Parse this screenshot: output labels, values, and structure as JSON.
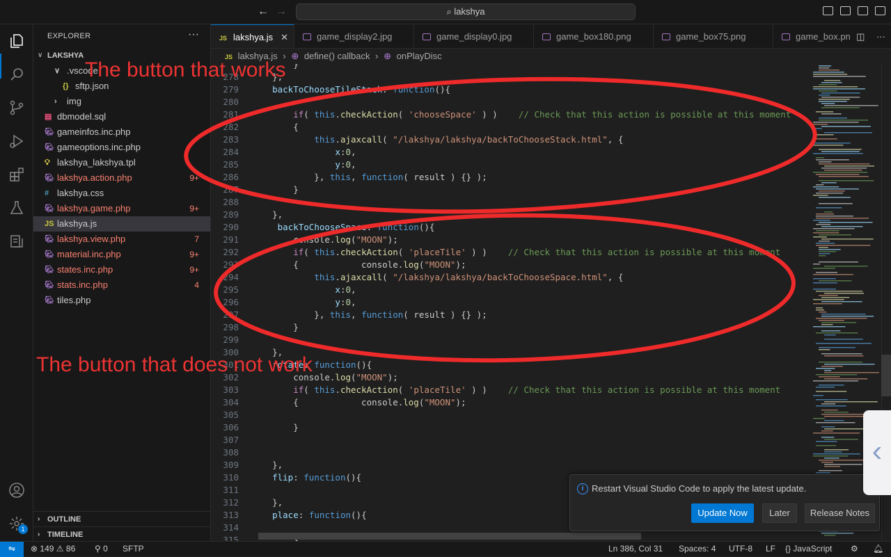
{
  "titlebar": {
    "search_text": "lakshya"
  },
  "explorer": {
    "title": "EXPLORER",
    "more": "···",
    "root": "LAKSHYA",
    "items": [
      {
        "name": ".vscode",
        "icon": "chevron-down",
        "color": "#cccccc"
      },
      {
        "name": "sftp.json",
        "icon": "{}",
        "color": "#cccccc"
      },
      {
        "name": "img",
        "icon": "chevron-right",
        "color": "#cccccc"
      },
      {
        "name": "dbmodel.sql",
        "icon": "database-icon",
        "color": "#cccccc"
      },
      {
        "name": "gameinfos.inc.php",
        "icon": "php-icon",
        "color": "#cccccc"
      },
      {
        "name": "gameoptions.inc.php",
        "icon": "php-icon",
        "color": "#cccccc"
      },
      {
        "name": "lakshya_lakshya.tpl",
        "icon": "bulb-icon",
        "color": "#cccccc"
      },
      {
        "name": "lakshya.action.php",
        "icon": "php-icon",
        "color": "#f88070",
        "badge": "9+"
      },
      {
        "name": "lakshya.css",
        "icon": "#",
        "color": "#cccccc"
      },
      {
        "name": "lakshya.game.php",
        "icon": "php-icon",
        "color": "#f88070",
        "badge": "9+"
      },
      {
        "name": "lakshya.js",
        "icon": "JS",
        "color": "#cccccc"
      },
      {
        "name": "lakshya.view.php",
        "icon": "php-icon",
        "color": "#f88070",
        "badge": "7"
      },
      {
        "name": "material.inc.php",
        "icon": "php-icon",
        "color": "#f88070",
        "badge": "9+"
      },
      {
        "name": "states.inc.php",
        "icon": "php-icon",
        "color": "#f88070",
        "badge": "9+"
      },
      {
        "name": "stats.inc.php",
        "icon": "php-icon",
        "color": "#f88070",
        "badge": "4"
      },
      {
        "name": "tiles.php",
        "icon": "php-icon",
        "color": "#cccccc"
      }
    ],
    "outline": "OUTLINE",
    "timeline": "TIMELINE"
  },
  "tabs": [
    {
      "label": "lakshya.js",
      "icon": "JS",
      "active": true
    },
    {
      "label": "game_display2.jpg",
      "icon": "image"
    },
    {
      "label": "game_display0.jpg",
      "icon": "image"
    },
    {
      "label": "game_box180.png",
      "icon": "image"
    },
    {
      "label": "game_box75.png",
      "icon": "image"
    },
    {
      "label": "game_box.pn",
      "icon": "image"
    }
  ],
  "breadcrumb": {
    "file": "lakshya.js",
    "sep": "›",
    "seg1": "define() callback",
    "seg2": "onPlayDisc"
  },
  "code_lines": [
    {
      "n": "",
      "t": "        }"
    },
    {
      "n": "278",
      "t": "    },"
    },
    {
      "n": "279",
      "t": "    backToChooseTileStack: function(){"
    },
    {
      "n": "280",
      "t": ""
    },
    {
      "n": "281",
      "t": "        if( this.checkAction( 'chooseSpace' ) )    // Check that this action is possible at this moment"
    },
    {
      "n": "282",
      "t": "        {"
    },
    {
      "n": "283",
      "t": "            this.ajaxcall( \"/lakshya/lakshya/backToChooseStack.html\", {"
    },
    {
      "n": "284",
      "t": "                x:0,"
    },
    {
      "n": "285",
      "t": "                y:0,"
    },
    {
      "n": "286",
      "t": "            }, this, function( result ) {} );"
    },
    {
      "n": "287",
      "t": "        }"
    },
    {
      "n": "288",
      "t": ""
    },
    {
      "n": "289",
      "t": "    },"
    },
    {
      "n": "290",
      "t": "     backToChooseSpace: function(){"
    },
    {
      "n": "291",
      "t": "        console.log(\"MOON\");"
    },
    {
      "n": "292",
      "t": "        if( this.checkAction( 'placeTile' ) )    // Check that this action is possible at this moment"
    },
    {
      "n": "293",
      "t": "        {            console.log(\"MOON\");"
    },
    {
      "n": "294",
      "t": "            this.ajaxcall( \"/lakshya/lakshya/backToChooseSpace.html\", {"
    },
    {
      "n": "295",
      "t": "                x:0,"
    },
    {
      "n": "296",
      "t": "                y:0,"
    },
    {
      "n": "297",
      "t": "            }, this, function( result ) {} );"
    },
    {
      "n": "298",
      "t": "        }"
    },
    {
      "n": "299",
      "t": ""
    },
    {
      "n": "300",
      "t": "    },"
    },
    {
      "n": "301",
      "t": "    rotate: function(){"
    },
    {
      "n": "302",
      "t": "        console.log(\"MOON\");"
    },
    {
      "n": "303",
      "t": "        if( this.checkAction( 'placeTile' ) )    // Check that this action is possible at this moment"
    },
    {
      "n": "304",
      "t": "        {            console.log(\"MOON\");"
    },
    {
      "n": "305",
      "t": ""
    },
    {
      "n": "306",
      "t": "        }"
    },
    {
      "n": "307",
      "t": ""
    },
    {
      "n": "308",
      "t": ""
    },
    {
      "n": "309",
      "t": "    },"
    },
    {
      "n": "310",
      "t": "    flip: function(){"
    },
    {
      "n": "311",
      "t": ""
    },
    {
      "n": "312",
      "t": "    },"
    },
    {
      "n": "313",
      "t": "    place: function(){"
    },
    {
      "n": "314",
      "t": ""
    },
    {
      "n": "315",
      "t": "        }"
    }
  ],
  "annotations": {
    "works": "The button that works",
    "not_works": "The button that does not work",
    "color": "#ee3333"
  },
  "notification": {
    "message": "Restart Visual Studio Code to apply the latest update.",
    "update_now": "Update Now",
    "later": "Later",
    "release_notes": "Release Notes"
  },
  "statusbar": {
    "errors": "149",
    "warnings": "86",
    "ports": "0",
    "sftp": "SFTP",
    "position": "Ln 386, Col 31",
    "spaces": "Spaces: 4",
    "encoding": "UTF-8",
    "eol": "LF",
    "language": "JavaScript",
    "language_prefix": "{}"
  },
  "settings_badge": "1",
  "colors": {
    "accent": "#0078d4",
    "error_file": "#f88070",
    "annotation": "#ee3333"
  }
}
